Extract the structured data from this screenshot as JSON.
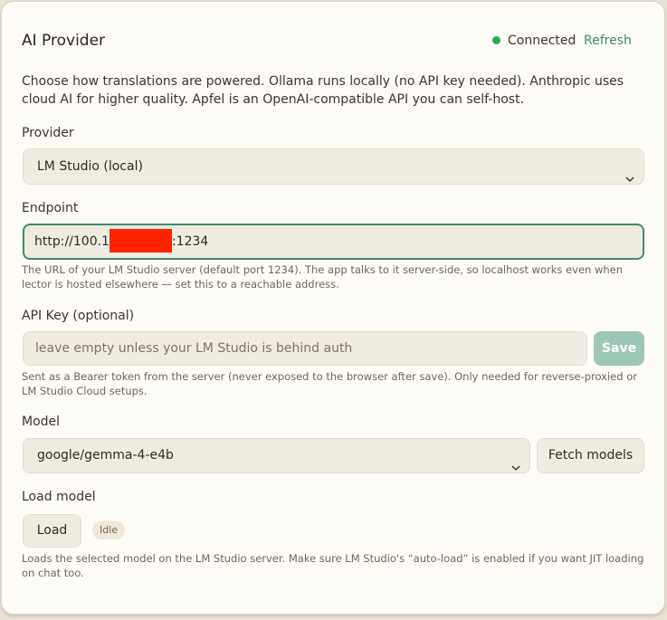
{
  "section": {
    "title": "AI Provider",
    "status_text": "Connected",
    "status_color": "#23b04f",
    "refresh_label": "Refresh",
    "description": "Choose how translations are powered. Ollama runs locally (no API key needed). Anthropic uses cloud AI for higher quality. Apfel is an OpenAI-compatible API you can self-host."
  },
  "provider": {
    "label": "Provider",
    "selected": "LM Studio (local)"
  },
  "endpoint": {
    "label": "Endpoint",
    "value_prefix": "http://100.1",
    "value_suffix": ":1234",
    "redaction_color": "#ff2200",
    "help": "The URL of your LM Studio server (default port 1234). The app talks to it server-side, so localhost works even when lector is hosted elsewhere — set this to a reachable address."
  },
  "api_key": {
    "label": "API Key (optional)",
    "placeholder": "leave empty unless your LM Studio is behind auth",
    "save_label": "Save",
    "help": "Sent as a Bearer token from the server (never exposed to the browser after save). Only needed for reverse-proxied or LM Studio Cloud setups."
  },
  "model": {
    "label": "Model",
    "selected": "google/gemma-4-e4b",
    "fetch_label": "Fetch models"
  },
  "load_model": {
    "label": "Load model",
    "load_label": "Load",
    "state_badge": "Idle",
    "help": "Loads the selected model on the LM Studio server. Make sure LM Studio's “auto-load” is enabled if you want JIT loading on chat too."
  },
  "colors": {
    "accent": "#3f8a6f",
    "save_button_bg": "#9dc8b8"
  },
  "icons": {
    "select_chevron": "chevron-down-icon"
  }
}
